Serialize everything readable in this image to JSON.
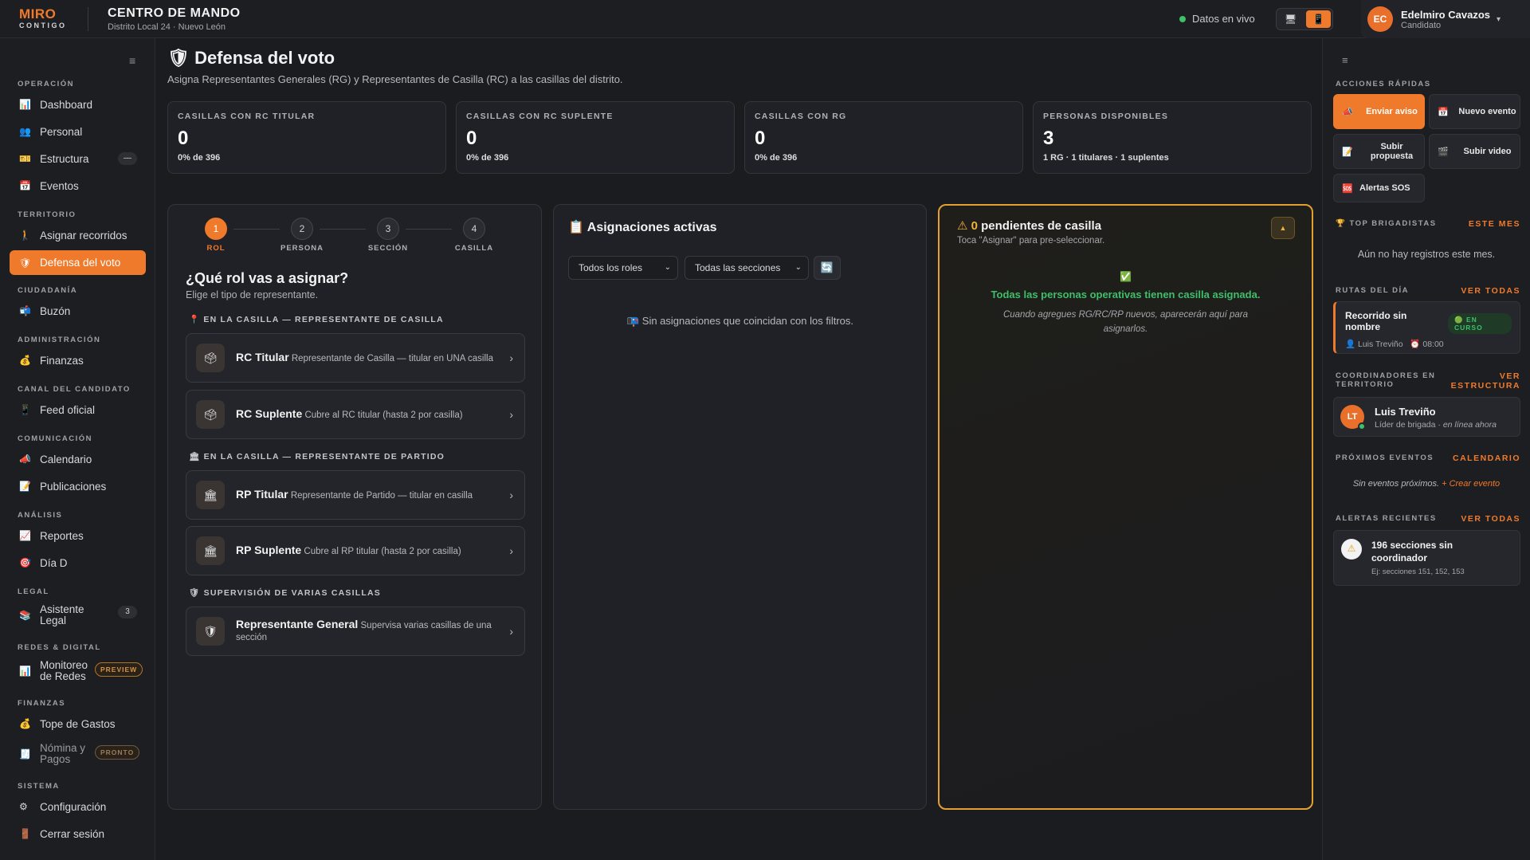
{
  "brand": {
    "line1": "MIRO",
    "line2": "CONTIGO"
  },
  "header": {
    "title": "CENTRO DE MANDO",
    "subtitle": "Distrito Local 24 · Nuevo León",
    "live": "Datos en vivo",
    "view_desktop": "🖥",
    "view_mobile": "📱"
  },
  "user": {
    "initials": "EC",
    "name": "Edelmiro Cavazos",
    "role": "Candidato",
    "caret": "▾"
  },
  "sidebar": {
    "hamb": "≡",
    "sections": [
      {
        "title": "OPERACIÓN",
        "items": [
          {
            "icon": "📊",
            "label": "Dashboard"
          },
          {
            "icon": "👥",
            "label": "Personal"
          },
          {
            "icon": "🎫",
            "label": "Estructura",
            "badge": "—"
          },
          {
            "icon": "📅",
            "label": "Eventos"
          }
        ]
      },
      {
        "title": "TERRITORIO",
        "items": [
          {
            "icon": "🚶",
            "label": "Asignar recorridos"
          },
          {
            "icon": "🛡",
            "label": "Defensa del voto",
            "active": true
          }
        ]
      },
      {
        "title": "CIUDADANÍA",
        "items": [
          {
            "icon": "📬",
            "label": "Buzón"
          }
        ]
      },
      {
        "title": "ADMINISTRACIÓN",
        "items": [
          {
            "icon": "💰",
            "label": "Finanzas"
          }
        ]
      },
      {
        "title": "CANAL DEL CANDIDATO",
        "items": [
          {
            "icon": "📱",
            "label": "Feed oficial"
          }
        ]
      },
      {
        "title": "COMUNICACIÓN",
        "items": [
          {
            "icon": "📣",
            "label": "Calendario"
          },
          {
            "icon": "📝",
            "label": "Publicaciones"
          }
        ]
      },
      {
        "title": "ANÁLISIS",
        "items": [
          {
            "icon": "📈",
            "label": "Reportes"
          },
          {
            "icon": "🎯",
            "label": "Día D"
          }
        ]
      },
      {
        "title": "LEGAL",
        "items": [
          {
            "icon": "📚",
            "label": "Asistente Legal",
            "badge": "3",
            "two": true
          }
        ]
      },
      {
        "title": "REDES & DIGITAL",
        "items": [
          {
            "icon": "📊",
            "label": "Monitoreo de Redes",
            "pill": "PREVIEW",
            "two": true
          }
        ]
      },
      {
        "title": "FINANZAS",
        "items": [
          {
            "icon": "💰",
            "label": "Tope de Gastos"
          },
          {
            "icon": "🧾",
            "label": "Nómina y Pagos",
            "pill": "PRONTO",
            "two": true,
            "dim": true
          }
        ]
      },
      {
        "title": "SISTEMA",
        "items": [
          {
            "icon": "⚙",
            "label": "Configuración"
          },
          {
            "icon": "🚪",
            "label": "Cerrar sesión"
          }
        ]
      }
    ]
  },
  "page": {
    "icon": "🛡",
    "title": "Defensa del voto",
    "subtitle": "Asigna Representantes Generales (RG) y Representantes de Casilla (RC) a las casillas del distrito."
  },
  "kpis": [
    {
      "label": "CASILLAS CON RC TITULAR",
      "value": "0",
      "foot": "0% de 396"
    },
    {
      "label": "CASILLAS CON RC SUPLENTE",
      "value": "0",
      "foot": "0% de 396"
    },
    {
      "label": "CASILLAS CON RG",
      "value": "0",
      "foot": "0% de 396"
    },
    {
      "label": "PERSONAS DISPONIBLES",
      "value": "3",
      "foot": "1 RG · 1 titulares · 1 suplentes"
    }
  ],
  "wizard": {
    "steps": [
      {
        "n": "1",
        "label": "ROL"
      },
      {
        "n": "2",
        "label": "PERSONA"
      },
      {
        "n": "3",
        "label": "SECCIÓN"
      },
      {
        "n": "4",
        "label": "CASILLA"
      }
    ],
    "question": "¿Qué rol vas a asignar?",
    "hint": "Elige el tipo de representante.",
    "groups": [
      "📍 EN LA CASILLA — REPRESENTANTE DE CASILLA",
      "🏛 EN LA CASILLA — REPRESENTANTE DE PARTIDO",
      "🛡 SUPERVISIÓN DE VARIAS CASILLAS"
    ],
    "roles": [
      {
        "icon": "🗳",
        "title": "RC Titular",
        "desc": "Representante de Casilla — titular en UNA casilla"
      },
      {
        "icon": "🗳",
        "title": "RC Suplente",
        "desc": "Cubre al RC titular (hasta 2 por casilla)"
      },
      {
        "icon": "🏛",
        "title": "RP Titular",
        "desc": "Representante de Partido — titular en casilla"
      },
      {
        "icon": "🏛",
        "title": "RP Suplente",
        "desc": "Cubre al RP titular (hasta 2 por casilla)"
      },
      {
        "icon": "🛡",
        "title": "Representante General",
        "desc": "Supervisa varias casillas de una sección"
      }
    ],
    "arrow": "›"
  },
  "assignments": {
    "icon": "📋",
    "title": "Asignaciones activas",
    "role_filter": "Todos los roles",
    "section_filter": "Todas las secciones",
    "refresh": "🔄",
    "empty": "📭 Sin asignaciones que coincidan con los filtros.",
    "caret": "⌄"
  },
  "pending": {
    "warn": "⚠",
    "count": "0",
    "title": "pendientes de casilla",
    "subtitle": "Toca \"Asignar\" para pre-seleccionar.",
    "toggle": "▲",
    "ok_icon": "✅",
    "ok_title": "Todas las personas operativas tienen casilla asignada.",
    "ok_sub": "Cuando agregues RG/RC/RP nuevos, aparecerán aquí para asignarlos."
  },
  "right": {
    "hamb": "≡",
    "quick_title": "ACCIONES RÁPIDAS",
    "quick": [
      {
        "icon": "📣",
        "label": "Enviar aviso"
      },
      {
        "icon": "📅",
        "label": "Nuevo evento"
      },
      {
        "icon": "📝",
        "label": "Subir propuesta"
      },
      {
        "icon": "🎬",
        "label": "Subir video"
      },
      {
        "icon": "🆘",
        "label": "Alertas SOS"
      }
    ],
    "top_title": "🏆 TOP BRIGADISTAS",
    "top_link": "ESTE MES",
    "top_empty": "Aún no hay registros este mes.",
    "routes_title": "RUTAS DEL DÍA",
    "routes_link": "VER TODAS",
    "route": {
      "name": "Recorrido sin nombre",
      "status": "🟢 EN CURSO",
      "person": "👤 Luis Treviño",
      "time": "⏰ 08:00"
    },
    "coord_title": "COORDINADORES EN TERRITORIO",
    "coord_link": "VER ESTRUCTURA",
    "coord": {
      "initials": "LT",
      "name": "Luis Treviño",
      "role": "Líder de brigada · ",
      "status": "en línea ahora"
    },
    "events_title": "PRÓXIMOS EVENTOS",
    "events_link": "CALENDARIO",
    "events_empty": "Sin eventos próximos.",
    "events_cta": "+ Crear evento",
    "alerts_title": "ALERTAS RECIENTES",
    "alerts_link": "VER TODAS",
    "alert": {
      "icon": "⚠",
      "title": "196 secciones sin coordinador",
      "sub": "Ej: secciones 151, 152, 153"
    }
  }
}
